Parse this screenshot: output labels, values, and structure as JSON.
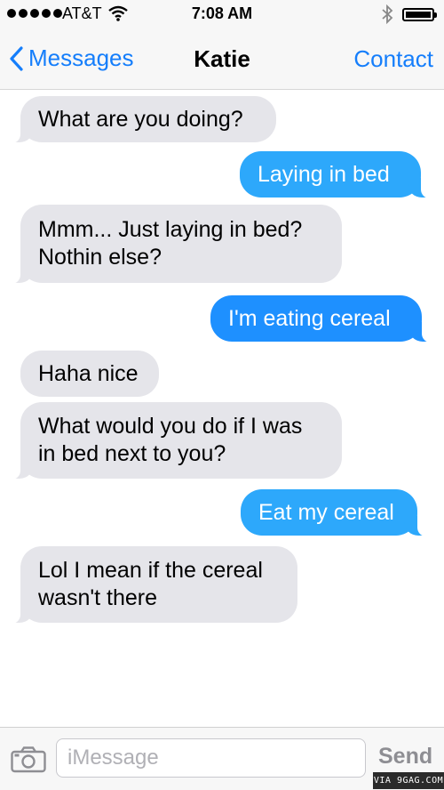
{
  "status_bar": {
    "carrier": "AT&T",
    "time": "7:08 AM"
  },
  "nav": {
    "back_label": "Messages",
    "title": "Katie",
    "contact_label": "Contact"
  },
  "messages": [
    {
      "from": "them",
      "text": "What are you doing?"
    },
    {
      "from": "me",
      "text": "Laying in bed"
    },
    {
      "from": "them",
      "text": "Mmm... Just laying in bed? Nothin else?"
    },
    {
      "from": "me",
      "text": "I'm eating cereal"
    },
    {
      "from": "them",
      "text": "Haha nice"
    },
    {
      "from": "them",
      "text": "What would you do if I was in bed next to you?"
    },
    {
      "from": "me",
      "text": "Eat my cereal"
    },
    {
      "from": "them",
      "text": "Lol I mean if the cereal wasn't there"
    }
  ],
  "input_bar": {
    "placeholder": "iMessage",
    "send_label": "Send"
  },
  "watermark": "VIA 9GAG.COM",
  "colors": {
    "accent": "#157efb",
    "outgoing_bubble": "#1e90ff",
    "incoming_bubble": "#e5e5ea"
  }
}
